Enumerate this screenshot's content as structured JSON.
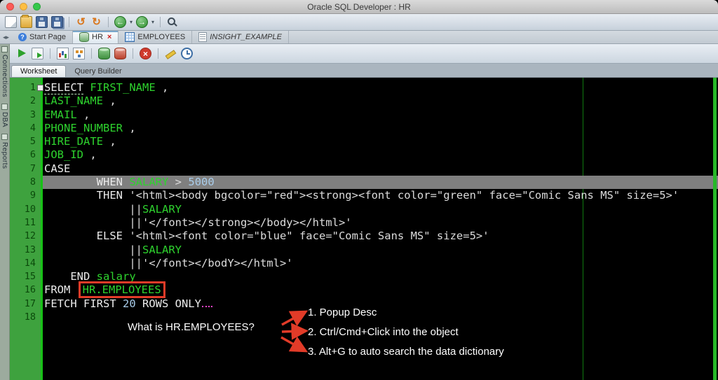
{
  "window": {
    "title": "Oracle SQL Developer : HR"
  },
  "main_toolbar": {
    "icons": [
      "new-file-icon",
      "open-folder-icon",
      "save-icon",
      "save-all-icon",
      "sep",
      "undo-icon",
      "redo-icon",
      "sep",
      "back-icon",
      "dropdown-icon",
      "forward-icon",
      "dropdown-icon",
      "sep",
      "search-db-icon"
    ]
  },
  "tab_bar": {
    "tabs": [
      {
        "label": "Start Page",
        "icon": "help-icon"
      },
      {
        "label": "HR",
        "icon": "database-icon",
        "active": true,
        "close": "×"
      },
      {
        "label": "EMPLOYEES",
        "icon": "table-icon"
      },
      {
        "label": "INSIGHT_EXAMPLE",
        "icon": "sheet-icon",
        "italic": true
      }
    ]
  },
  "sidebar": {
    "items": [
      "Connections",
      "DBA",
      "Reports"
    ]
  },
  "worksheet_toolbar": {
    "icons": [
      "run-statement-icon",
      "run-script-icon",
      "sep",
      "autotrace-icon",
      "explain-plan-icon",
      "sep",
      "commit-icon",
      "rollback-icon",
      "sep",
      "cancel-icon",
      "sep",
      "clear-icon",
      "history-icon"
    ]
  },
  "doc_tabs": {
    "tabs": [
      {
        "label": "Worksheet",
        "active": true
      },
      {
        "label": "Query Builder"
      }
    ]
  },
  "editor": {
    "highlight_line": 8,
    "lines": [
      {
        "n": 1,
        "segs": [
          [
            "SELECT",
            "kw u"
          ],
          [
            " ",
            "sp"
          ],
          [
            "FIRST_NAME",
            "id"
          ],
          [
            " ,",
            "pun"
          ]
        ]
      },
      {
        "n": 2,
        "segs": [
          [
            "LAST_NAME",
            "id"
          ],
          [
            " ,",
            "pun"
          ]
        ]
      },
      {
        "n": 3,
        "segs": [
          [
            "EMAIL",
            "id"
          ],
          [
            " ,",
            "pun"
          ]
        ]
      },
      {
        "n": 4,
        "segs": [
          [
            "PHONE_NUMBER",
            "id"
          ],
          [
            " ,",
            "pun"
          ]
        ]
      },
      {
        "n": 5,
        "segs": [
          [
            "HIRE_DATE",
            "id"
          ],
          [
            " ,",
            "pun"
          ]
        ]
      },
      {
        "n": 6,
        "segs": [
          [
            "JOB_ID",
            "id"
          ],
          [
            " ,",
            "pun"
          ]
        ]
      },
      {
        "n": 7,
        "segs": [
          [
            "CASE",
            "kw"
          ]
        ]
      },
      {
        "n": 8,
        "hl": true,
        "segs": [
          [
            "        ",
            "sp"
          ],
          [
            "WHEN",
            "kw"
          ],
          [
            " ",
            "sp"
          ],
          [
            "SALARY",
            "id"
          ],
          [
            " ",
            "sp"
          ],
          [
            ">",
            "pun"
          ],
          [
            " ",
            "sp"
          ],
          [
            "5000",
            "num"
          ]
        ]
      },
      {
        "n": 9,
        "segs": [
          [
            "        ",
            "sp"
          ],
          [
            "THEN",
            "kw"
          ],
          [
            " ",
            "sp"
          ],
          [
            "'<html><body bgcolor=\"red\"><strong><font color=\"green\" face=\"Comic Sans MS\" size=5>'",
            "str"
          ]
        ]
      },
      {
        "n": 10,
        "segs": [
          [
            "             ",
            "sp"
          ],
          [
            "||",
            "pun"
          ],
          [
            "SALARY",
            "id"
          ]
        ]
      },
      {
        "n": 11,
        "segs": [
          [
            "             ",
            "sp"
          ],
          [
            "||",
            "pun"
          ],
          [
            "'</font></strong></body></html>'",
            "str"
          ]
        ]
      },
      {
        "n": 12,
        "segs": [
          [
            "        ",
            "sp"
          ],
          [
            "ELSE",
            "kw"
          ],
          [
            " ",
            "sp"
          ],
          [
            "'<html><font color=\"blue\" face=\"Comic Sans MS\" size=5>'",
            "str"
          ]
        ]
      },
      {
        "n": 13,
        "segs": [
          [
            "             ",
            "sp"
          ],
          [
            "||",
            "pun"
          ],
          [
            "SALARY",
            "id"
          ]
        ]
      },
      {
        "n": 14,
        "segs": [
          [
            "             ",
            "sp"
          ],
          [
            "||",
            "pun"
          ],
          [
            "'</font></bodY></html>'",
            "str"
          ]
        ]
      },
      {
        "n": 15,
        "segs": [
          [
            "    ",
            "sp"
          ],
          [
            "END",
            "kw"
          ],
          [
            " ",
            "sp"
          ],
          [
            "salary",
            "id"
          ]
        ]
      },
      {
        "n": 16,
        "segs": [
          [
            "FROM",
            "kw"
          ],
          [
            " ",
            "sp"
          ],
          [
            "HR.EMPLOYEES",
            "id boxed"
          ]
        ]
      },
      {
        "n": 17,
        "segs": [
          [
            "FETCH FIRST ",
            "kw"
          ],
          [
            "20",
            "num"
          ],
          [
            " ROWS ONLY",
            "kw"
          ],
          [
            "",
            "caret"
          ]
        ]
      },
      {
        "n": 18,
        "segs": []
      }
    ]
  },
  "annotation": {
    "question": "What is HR.EMPLOYEES?",
    "items": [
      "1. Popup Desc",
      "2. Ctrl/Cmd+Click into the object",
      "3. Alt+G to auto search the data dictionary"
    ]
  },
  "colors": {
    "identifier_green": "#2ed32e",
    "keyword_white": "#ececec",
    "number_blue": "#a9cdeb",
    "gutter_green": "#3ea23e",
    "highlight_gray": "#7f7f7f",
    "annotation_red": "#e23b28"
  }
}
